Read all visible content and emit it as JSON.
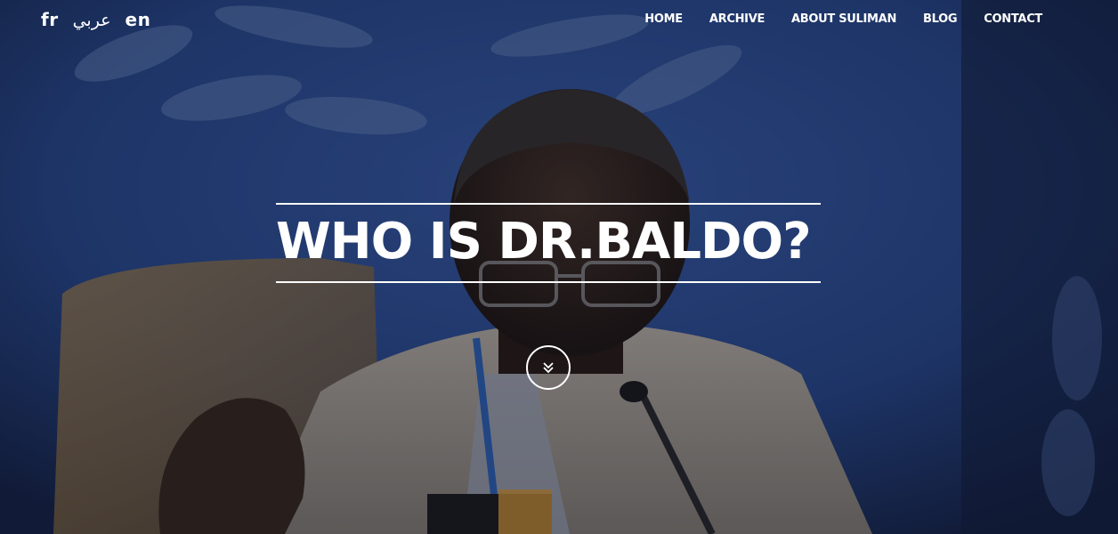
{
  "languages": [
    {
      "code": "fr",
      "label": "fr"
    },
    {
      "code": "ar",
      "label": "عربي"
    },
    {
      "code": "en",
      "label": "en"
    }
  ],
  "nav": {
    "items": [
      {
        "label": "HOME"
      },
      {
        "label": "ARCHIVE"
      },
      {
        "label": "ABOUT SULIMAN"
      },
      {
        "label": "BLOG"
      },
      {
        "label": "CONTACT"
      }
    ]
  },
  "hero": {
    "title": "WHO IS DR.BALDO?",
    "scroll_icon": "double-chevron-down-icon"
  },
  "colors": {
    "text": "#ffffff",
    "background_blue": "#2b4a8a",
    "overlay": "#0a0e1e"
  }
}
